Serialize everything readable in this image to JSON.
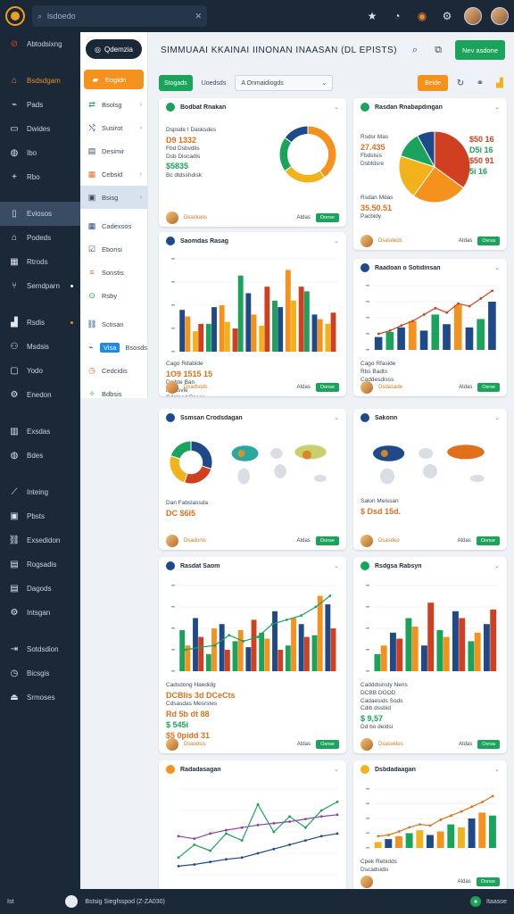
{
  "colors": {
    "navy": "#1b2838",
    "green": "#1aa35a",
    "orange": "#f5921e",
    "blue": "#1e4a8a",
    "red": "#d04020",
    "yellow": "#f2b21c"
  },
  "topbar": {
    "search_text": "lsdoedo",
    "search_icon": "search-icon",
    "clear_icon": "x-icon"
  },
  "leftnav": {
    "items": [
      {
        "label": "Abtodsixng",
        "icon": "ban-icon"
      },
      {
        "label": "Bsdsdgam",
        "icon": "home-icon",
        "orange": true
      },
      {
        "label": "Pads",
        "icon": "tag-icon"
      },
      {
        "label": "Dwides",
        "icon": "card-icon"
      },
      {
        "label": "Ibo",
        "icon": "disc-icon"
      },
      {
        "label": "Rbo",
        "icon": "plus-icon"
      },
      {
        "label": "Eviosos",
        "icon": "tablet-icon",
        "active": true
      },
      {
        "label": "Podeds",
        "icon": "house-icon"
      },
      {
        "label": "Rtrods",
        "icon": "grid-icon"
      },
      {
        "label": "Semdparn",
        "icon": "branch-icon"
      },
      {
        "label": "Rsdis",
        "icon": "chart-icon"
      },
      {
        "label": "Msdsis",
        "icon": "users-icon"
      },
      {
        "label": "Yodo",
        "icon": "monitor-icon"
      },
      {
        "label": "Enedon",
        "icon": "gear-icon"
      },
      {
        "label": "Exsdas",
        "icon": "building-icon"
      },
      {
        "label": "Bdes",
        "icon": "globe-icon"
      },
      {
        "label": "Inteing",
        "icon": "trend-icon"
      },
      {
        "label": "Pbsts",
        "icon": "image-icon"
      },
      {
        "label": "Exsedidon",
        "icon": "link-icon"
      },
      {
        "label": "Rogsadis",
        "icon": "table-icon"
      },
      {
        "label": "Dagods",
        "icon": "doc-icon"
      },
      {
        "label": "Intsgan",
        "icon": "settings-icon"
      },
      {
        "label": "Sotdsdion",
        "icon": "export-icon"
      },
      {
        "label": "Bicsgis",
        "icon": "clock-icon"
      },
      {
        "label": "Srmoses",
        "icon": "logout-icon"
      }
    ]
  },
  "subnav": {
    "pill": "Qdemzia",
    "items": [
      {
        "label": "Eogidn",
        "icon": "folder-icon",
        "style": "orange"
      },
      {
        "label": "Bsolsg",
        "icon": "flow-icon",
        "chev": true
      },
      {
        "label": "Susirot",
        "icon": "shuffle-icon",
        "chev": true
      },
      {
        "label": "Desimir",
        "icon": "doc-icon"
      },
      {
        "label": "Cebsid",
        "icon": "sheet-icon",
        "chev": true
      },
      {
        "label": "Bsisg",
        "icon": "box-icon",
        "style": "selected",
        "chev": true
      },
      {
        "label": "Cadexsos",
        "icon": "grid-icon"
      },
      {
        "label": "Ebonsi",
        "icon": "check-icon"
      },
      {
        "label": "Sonstis",
        "icon": "list-icon"
      },
      {
        "label": "Rsby",
        "icon": "pin-icon"
      },
      {
        "label": "Sctisan",
        "icon": "link-icon"
      },
      {
        "label": "Bsosds",
        "icon": "tag-icon",
        "style": "blue",
        "badge": "Visa"
      },
      {
        "label": "Cedcidis",
        "icon": "clock-icon"
      },
      {
        "label": "Bdbsis",
        "icon": "tool-icon"
      }
    ]
  },
  "header": {
    "title": "SIMMUAAI KKAINAI IINONAN INAASAN (DL EPISTS)",
    "new_button": "Nev asdone"
  },
  "toolbar": {
    "tab_active": "Stogads",
    "tab2": "Uoedsds",
    "select_value": "A Onmaidiogds",
    "filter": "Beide"
  },
  "cards": [
    {
      "title": "Bodbat Rnakan",
      "kpi": [
        "Dspsde I Dasksdes",
        "D9 1332",
        "Fbd Dsbvdlis",
        "Dsb Diocadis",
        "$5835",
        "Bc dtdsshdisk"
      ],
      "foot": "Dsaskass",
      "more": "Atdas",
      "btn": "Oonse"
    },
    {
      "title": "Rasdan Rnabapdingan",
      "kpi": [
        "Rsdsr Mas",
        "27.435",
        "Fbdslsis",
        "Dsbfdsre",
        "Rsdan Mdas",
        "35.50.51",
        "Pacbidy",
        "$50 16",
        "D5i 16",
        "$50 91",
        "5i 16"
      ],
      "foot": "Dsasdeds",
      "more": "Atdas",
      "btn": "Ovrsa"
    },
    {
      "title": "Saomdas Rasag",
      "kpi": [
        "Cago Rdabide",
        "1O9 1515 15",
        "Deibte Ban",
        "Abdisvle",
        "Cdeipad Bsses"
      ],
      "foot": "Dsadsods",
      "more": "Atdas",
      "btn": "Oonse"
    },
    {
      "title": "Raadoan o Sotidinsan",
      "kpi": [
        "Cago Rfaside",
        "Rbs Badts",
        "Coddesdisss"
      ],
      "foot": "Dsdasade",
      "more": "Atdas",
      "btn": "Osrse"
    },
    {
      "title": "Ssmsan Crodsdagan",
      "kpi": [
        "Dan Fabslassda",
        "DC $6i5"
      ],
      "foot": "Dsadonis",
      "more": "Atdas",
      "btn": "Oonse"
    },
    {
      "title": "Sakonn",
      "kpi": [
        "Salon Meissan",
        "$ Dsd 15d."
      ],
      "foot": "Dsasdeo",
      "more": "Atdas",
      "btn": "Oonse"
    },
    {
      "title": "Rasdat Saom",
      "kpi": [
        "Cadsdong Haedidg",
        "DCBlis 3d DCeCts",
        "Cdsasdas Mesrstes",
        "Rd 5b dt 88",
        "$ 545i",
        "$5 0pidd 31"
      ],
      "foot": "Dsaodsis",
      "more": "Atdas",
      "btn": "Osnse"
    },
    {
      "title": "Rsdgsa Rabsyn",
      "kpi": [
        "Cadddsinsty Nens",
        "DCBB DOOD",
        "Cadaesids Sods",
        "Cdib dssbid",
        "$ 9,57",
        "Dd bo deidsi"
      ],
      "foot": "Dsaswdes",
      "more": "Atdas",
      "btn": "Ovrsa"
    },
    {
      "title": "Radadasagan",
      "foot": "",
      "more": "",
      "btn": ""
    },
    {
      "title": "Dsbdadaagan",
      "kpi": [
        "Cpek Rebidds",
        "Dscadsidis"
      ],
      "foot": "",
      "more": "Atdas",
      "btn": "Oonse"
    }
  ],
  "chart_data": [
    {
      "type": "pie",
      "values": [
        40,
        25,
        20,
        15
      ]
    },
    {
      "type": "pie",
      "values": [
        35,
        25,
        20,
        12,
        8
      ]
    },
    {
      "type": "bar",
      "series": [
        {
          "name": "",
          "values": [
            45,
            22,
            30,
            50,
            25,
            63,
            28,
            55,
            88,
            70,
            40,
            30
          ]
        },
        {
          "name": "",
          "values": [
            38,
            30,
            48,
            32,
            82,
            40,
            70,
            48,
            55,
            65,
            35,
            42
          ]
        }
      ]
    },
    {
      "type": "bar",
      "series": [
        {
          "name": "",
          "values": [
            20,
            28,
            35,
            45,
            30,
            55,
            40,
            70,
            35,
            48,
            75
          ]
        }
      ],
      "line": [
        25,
        30,
        38,
        45,
        55,
        65,
        58,
        72,
        68,
        80,
        92
      ]
    },
    {
      "type": "bar",
      "series": [
        {
          "name": "",
          "values": [
            48,
            62,
            20,
            55,
            35,
            28,
            45,
            70,
            30,
            55,
            42,
            78
          ]
        },
        {
          "name": "",
          "values": [
            30,
            40,
            50,
            25,
            48,
            60,
            38,
            25,
            62,
            40,
            88,
            50
          ]
        }
      ],
      "line": [
        25,
        28,
        30,
        42,
        35,
        40,
        55,
        60,
        65,
        75,
        88
      ]
    },
    {
      "type": "bar",
      "series": [
        {
          "name": "",
          "values": [
            20,
            45,
            62,
            30,
            48,
            70,
            35,
            55
          ]
        },
        {
          "name": "",
          "values": [
            30,
            38,
            52,
            80,
            40,
            62,
            45,
            72
          ]
        }
      ]
    },
    {
      "type": "line",
      "series": [
        {
          "name": "",
          "values": [
            45,
            42,
            48,
            52,
            55,
            58,
            60,
            62,
            65,
            68,
            70
          ]
        },
        {
          "name": "",
          "values": [
            20,
            35,
            28,
            48,
            40,
            82,
            50,
            68,
            55,
            75,
            85
          ]
        },
        {
          "name": "",
          "values": [
            10,
            12,
            15,
            18,
            20,
            25,
            30,
            35,
            40,
            45,
            48
          ]
        }
      ]
    },
    {
      "type": "bar",
      "series": [
        {
          "name": "",
          "values": [
            10,
            15,
            20,
            25,
            30,
            22,
            28,
            40,
            35,
            50,
            60,
            55
          ]
        }
      ],
      "line": [
        20,
        22,
        28,
        35,
        40,
        38,
        48,
        55,
        62,
        70,
        78,
        88
      ]
    }
  ],
  "bottombar": {
    "left": "Ist",
    "status": "Bstsig Siegfsspod (Z-ZA030)",
    "right": "Itaasoe"
  }
}
